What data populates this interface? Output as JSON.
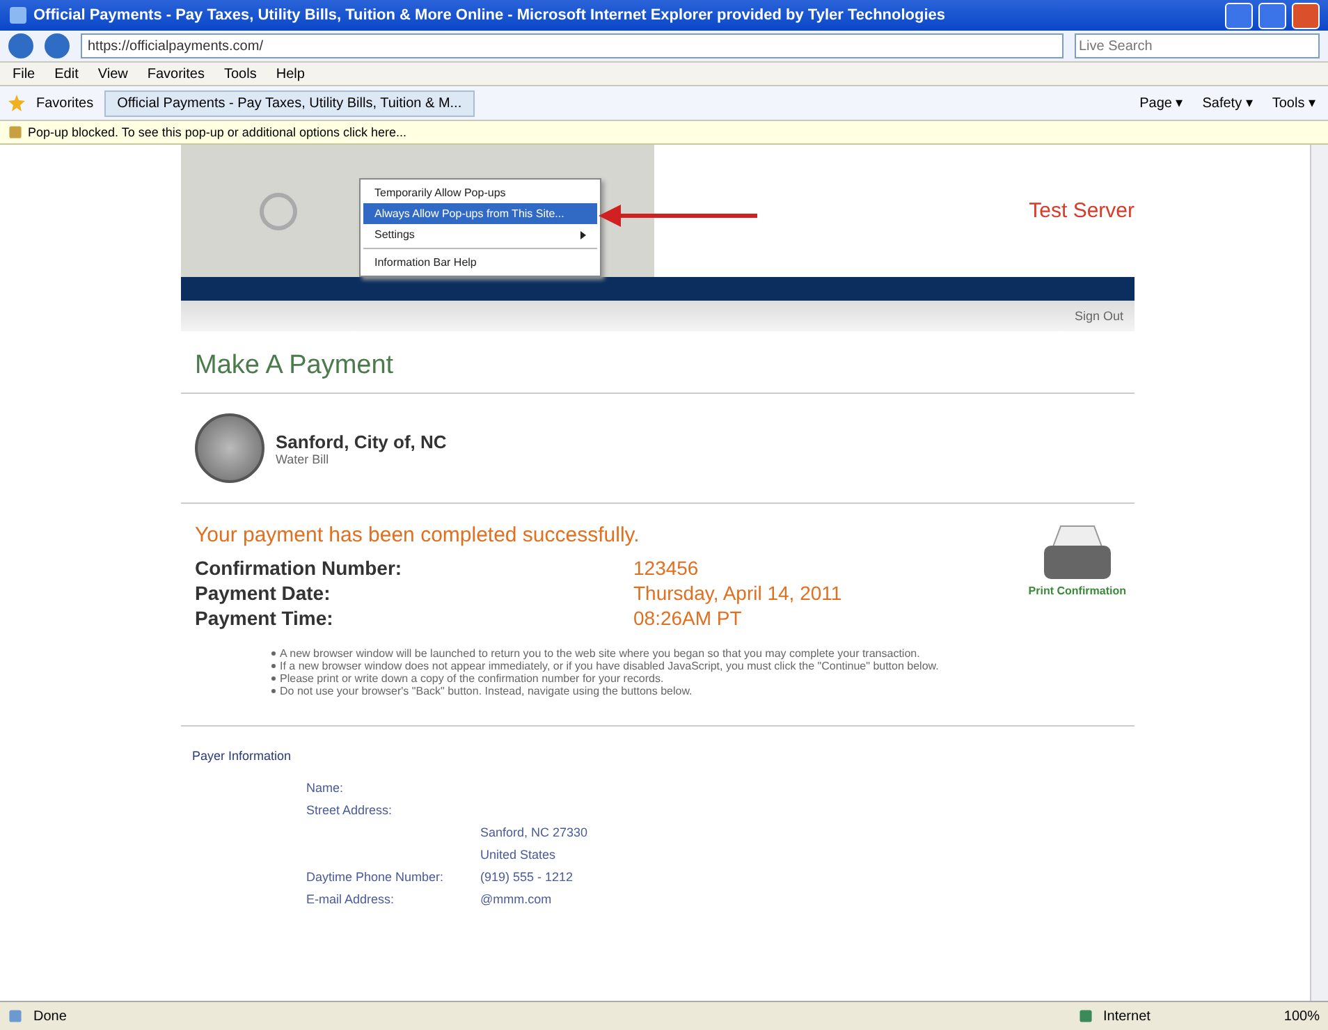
{
  "window": {
    "title": "Official Payments - Pay Taxes, Utility Bills, Tuition & More Online - Microsoft Internet Explorer provided by Tyler Technologies"
  },
  "address_bar": {
    "value": "https://officialpayments.com/",
    "search_placeholder": "Live Search"
  },
  "menu": [
    "File",
    "Edit",
    "View",
    "Favorites",
    "Tools",
    "Help"
  ],
  "favorites_bar": {
    "label": "Favorites",
    "tab": "Official Payments - Pay Taxes, Utility Bills, Tuition & M...",
    "tools": [
      "Page ▾",
      "Safety ▾",
      "Tools ▾"
    ]
  },
  "info_bar": {
    "text": "Pop-up blocked. To see this pop-up or additional options click here..."
  },
  "popup_menu": [
    {
      "label": "Temporarily Allow Pop-ups",
      "selected": false,
      "kind": "item"
    },
    {
      "label": "Always Allow Pop-ups from This Site...",
      "selected": true,
      "kind": "item"
    },
    {
      "label": "Settings",
      "selected": false,
      "kind": "submenu"
    },
    {
      "label": "Information Bar Help",
      "selected": false,
      "kind": "item"
    }
  ],
  "header": {
    "server": "Test Server",
    "link": "Sign Out"
  },
  "page_title": "Make A Payment",
  "payee": {
    "name": "Sanford, City of, NC",
    "subtitle": "Water Bill"
  },
  "confirmation": {
    "message": "Your payment has been completed successfully.",
    "rows": [
      {
        "label": "Confirmation Number:",
        "value": "123456"
      },
      {
        "label": "Payment Date:",
        "value": "Thursday, April 14, 2011"
      },
      {
        "label": "Payment Time:",
        "value": "08:26AM PT"
      }
    ],
    "print_label": "Print Confirmation",
    "notes": [
      "A new browser window will be launched to return you to the web site where you began so that you may complete your transaction.",
      "If a new browser window does not appear immediately, or if you have disabled JavaScript, you must click the \"Continue\" button below.",
      "Please print or write down a copy of the confirmation number for your records.",
      "Do not use your browser's \"Back\" button. Instead, navigate using the buttons below."
    ]
  },
  "payer": {
    "title": "Payer Information",
    "fields": [
      {
        "label": "Name:"
      },
      {
        "label": "Street Address:"
      },
      {
        "value": "Sanford, NC 27330"
      },
      {
        "value": "United States"
      },
      {
        "label": "Daytime Phone Number:",
        "value": "(919) 555 - 1212"
      },
      {
        "label": "E-mail Address:",
        "value": "@mmm.com"
      }
    ]
  },
  "status_bar": {
    "status": "Done",
    "zone": "Internet",
    "zoom": "100%"
  }
}
